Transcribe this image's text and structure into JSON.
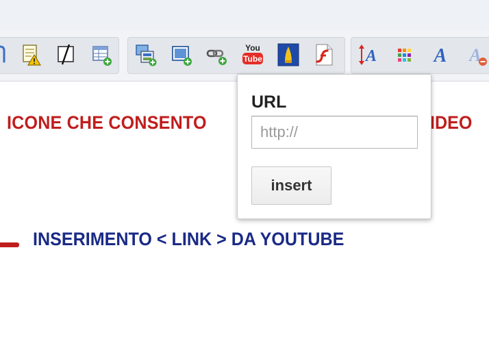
{
  "editor": {
    "toolbar": {
      "groups": [
        {
          "name": "edit-tools",
          "items": [
            {
              "icon": "partial-tool-icon"
            },
            {
              "icon": "notes-warning-icon"
            },
            {
              "icon": "remove-format-icon"
            },
            {
              "icon": "table-add-icon"
            }
          ]
        },
        {
          "name": "insert-media",
          "items": [
            {
              "icon": "insert-image-icon"
            },
            {
              "icon": "insert-picture-icon"
            },
            {
              "icon": "insert-link-icon"
            },
            {
              "icon": "youtube-icon",
              "text_top": "You",
              "text_bottom": "Tube"
            },
            {
              "icon": "insert-media-icon"
            },
            {
              "icon": "flash-icon"
            }
          ]
        },
        {
          "name": "text-format",
          "items": [
            {
              "icon": "font-size-icon"
            },
            {
              "icon": "color-palette-icon"
            },
            {
              "icon": "font-style-icon"
            },
            {
              "icon": "clear-font-icon"
            }
          ]
        }
      ],
      "colors": {
        "youtube_red": "#e52d27",
        "accent_blue": "#3b6fc4"
      }
    },
    "content": {
      "line1_visible": "ICONE CHE CONSENTO",
      "line1_tail": "IDEO",
      "line1_color": "#c01d1d",
      "line2": "INSERIMENTO < LINK > DA YOUTUBE",
      "line2_color": "#1a2a86"
    }
  },
  "popup": {
    "label": "URL",
    "url_input": {
      "value": "",
      "placeholder": "http://"
    },
    "insert_label": "insert"
  }
}
